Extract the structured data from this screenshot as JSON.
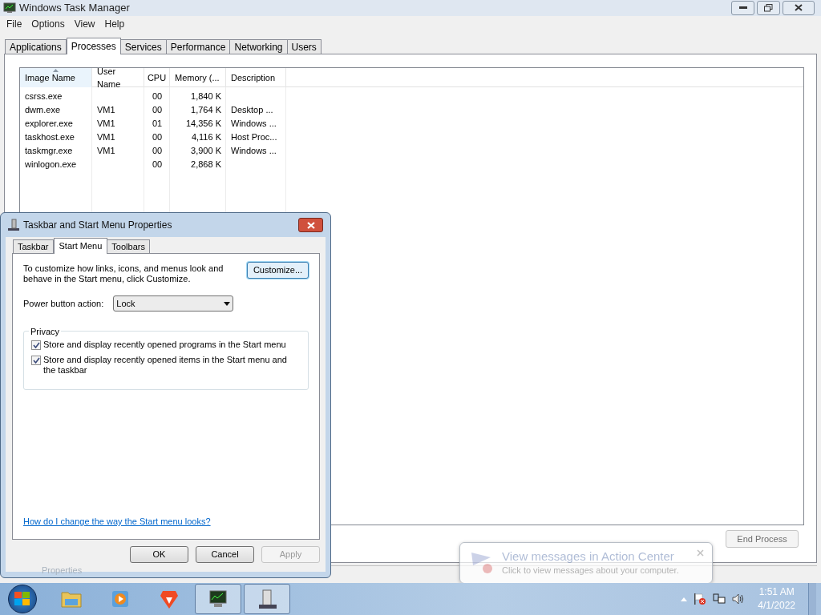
{
  "window": {
    "title": "Windows Task Manager"
  },
  "menu": [
    "File",
    "Options",
    "View",
    "Help"
  ],
  "tabs": [
    {
      "label": "Applications",
      "selected": false
    },
    {
      "label": "Processes",
      "selected": true
    },
    {
      "label": "Services",
      "selected": false
    },
    {
      "label": "Performance",
      "selected": false
    },
    {
      "label": "Networking",
      "selected": false
    },
    {
      "label": "Users",
      "selected": false
    }
  ],
  "table": {
    "columns": [
      {
        "label": "Image Name",
        "sorted": true
      },
      {
        "label": "User Name",
        "sorted": false
      },
      {
        "label": "CPU",
        "sorted": false
      },
      {
        "label": "Memory (...",
        "sorted": false
      },
      {
        "label": "Description",
        "sorted": false
      }
    ],
    "rows": [
      [
        "csrss.exe",
        "",
        "00",
        "1,840 K",
        ""
      ],
      [
        "dwm.exe",
        "VM1",
        "00",
        "1,764 K",
        "Desktop ..."
      ],
      [
        "explorer.exe",
        "VM1",
        "01",
        "14,356 K",
        "Windows ..."
      ],
      [
        "taskhost.exe",
        "VM1",
        "00",
        "4,116 K",
        "Host Proc..."
      ],
      [
        "taskmgr.exe",
        "VM1",
        "00",
        "3,900 K",
        "Windows ..."
      ],
      [
        "winlogon.exe",
        "",
        "00",
        "2,868 K",
        ""
      ]
    ]
  },
  "end_process_button": "End Process",
  "status_bar_ghost": "Properties",
  "dialog": {
    "title": "Taskbar and Start Menu Properties",
    "tabs": [
      {
        "label": "Taskbar",
        "selected": false
      },
      {
        "label": "Start Menu",
        "selected": true
      },
      {
        "label": "Toolbars",
        "selected": false
      }
    ],
    "description": "To customize how links, icons, and menus look and behave in the Start menu, click Customize.",
    "customize_button": "Customize...",
    "power_label": "Power button action:",
    "power_value": "Lock",
    "privacy_title": "Privacy",
    "checkboxes": [
      {
        "label": "Store and display recently opened programs in the Start menu",
        "checked": true
      },
      {
        "label": "Store and display recently opened items in the Start menu and the taskbar",
        "checked": true
      }
    ],
    "help_link": "How do I change the way the Start menu looks?",
    "buttons": [
      {
        "label": "OK",
        "disabled": false
      },
      {
        "label": "Cancel",
        "disabled": false
      },
      {
        "label": "Apply",
        "disabled": true
      }
    ]
  },
  "notification": {
    "title": "View messages in Action Center",
    "message": "Click to view messages about your computer."
  },
  "taskbar": {
    "items": [
      {
        "kind": "explorer",
        "active": false
      },
      {
        "kind": "media",
        "active": false
      },
      {
        "kind": "browser",
        "active": false
      },
      {
        "kind": "taskmgr",
        "active": true
      },
      {
        "kind": "properties",
        "active": true
      }
    ],
    "time": "1:51 AM",
    "date": "4/1/2022"
  }
}
